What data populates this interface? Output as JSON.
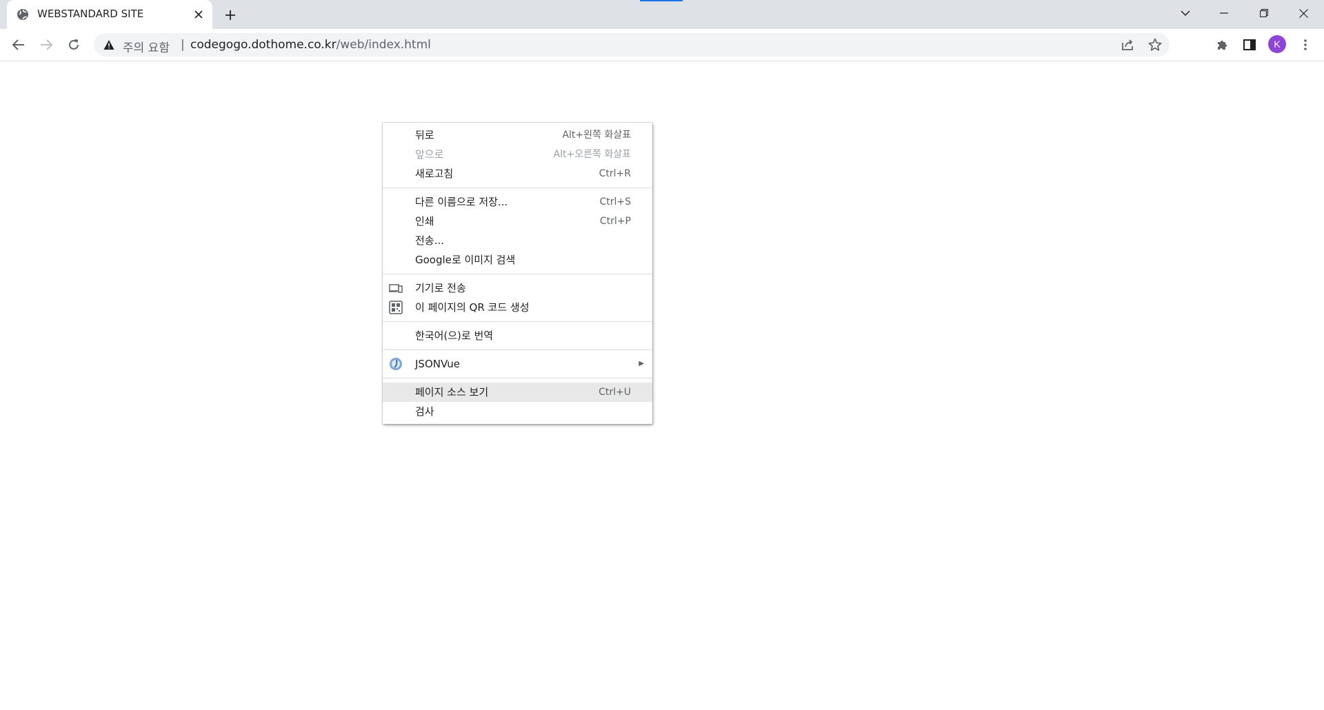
{
  "browser": {
    "tab": {
      "title": "WEBSTANDARD SITE",
      "favicon": "globe-icon"
    },
    "omnibox": {
      "security_label": "주의 요함",
      "separator": "|",
      "url_host": "codegogo.dothome.co.kr",
      "url_path": "/web/index.html"
    },
    "profile_initial": "K",
    "colors": {
      "tabstrip": "#dee1e6",
      "avatar": "#8e44d6",
      "accent": "#1a73e8"
    }
  },
  "context_menu": {
    "groups": [
      [
        {
          "label": "뒤로",
          "shortcut": "Alt+왼쪽 화살표",
          "disabled": false
        },
        {
          "label": "앞으로",
          "shortcut": "Alt+오른쪽 화살표",
          "disabled": true
        },
        {
          "label": "새로고침",
          "shortcut": "Ctrl+R",
          "disabled": false
        }
      ],
      [
        {
          "label": "다른 이름으로 저장...",
          "shortcut": "Ctrl+S"
        },
        {
          "label": "인쇄",
          "shortcut": "Ctrl+P"
        },
        {
          "label": "전송..."
        },
        {
          "label": "Google로 이미지 검색"
        }
      ],
      [
        {
          "label": "기기로 전송",
          "icon": "devices-icon"
        },
        {
          "label": "이 페이지의 QR 코드 생성",
          "icon": "qr-code-icon"
        }
      ],
      [
        {
          "label": "한국어(으)로 번역"
        }
      ],
      [
        {
          "label": "JSONVue",
          "icon": "jsonvue-icon",
          "submenu": true
        }
      ],
      [
        {
          "label": "페이지 소스 보기",
          "shortcut": "Ctrl+U",
          "highlighted": true
        },
        {
          "label": "검사"
        }
      ]
    ]
  }
}
